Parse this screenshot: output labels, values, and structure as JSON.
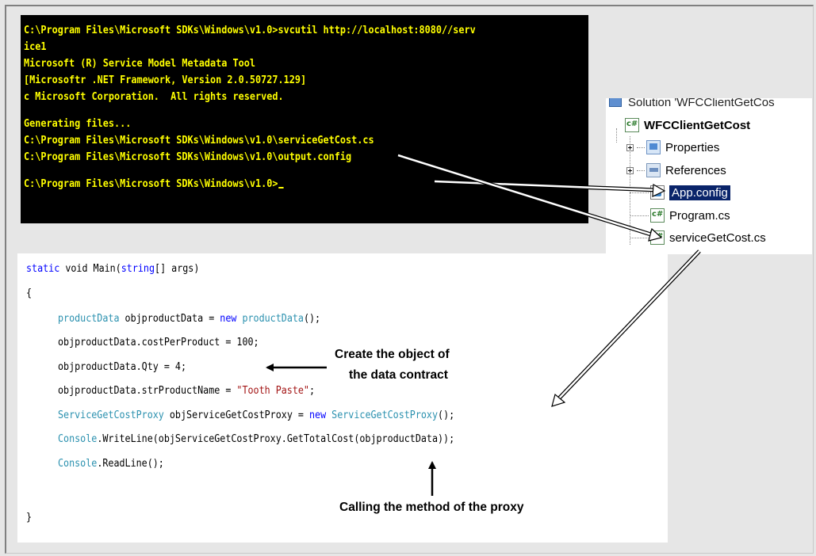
{
  "console": {
    "lines": [
      "C:\\Program Files\\Microsoft SDKs\\Windows\\v1.0>svcutil http://localhost:8080//serv",
      "ice1",
      "Microsoft (R) Service Model Metadata Tool",
      "[Microsoftr .NET Framework, Version 2.0.50727.129]",
      "c Microsoft Corporation.  All rights reserved.",
      "",
      "Generating files...",
      "C:\\Program Files\\Microsoft SDKs\\Windows\\v1.0\\serviceGetCost.cs",
      "C:\\Program Files\\Microsoft SDKs\\Windows\\v1.0\\output.config",
      "",
      "C:\\Program Files\\Microsoft SDKs\\Windows\\v1.0>"
    ]
  },
  "solution_explorer": {
    "solution_label": "Solution 'WFCClientGetCos",
    "project": "WFCClientGetCost",
    "items": [
      {
        "label": "Properties",
        "icon": "properties-folder-icon"
      },
      {
        "label": "References",
        "icon": "references-icon"
      },
      {
        "label": "App.config",
        "icon": "config-file-icon",
        "selected": true
      },
      {
        "label": "Program.cs",
        "icon": "csharp-file-icon"
      },
      {
        "label": "serviceGetCost.cs",
        "icon": "csharp-file-icon"
      }
    ]
  },
  "code": {
    "signature": [
      "static",
      " void Main(",
      "string",
      "[] args)"
    ],
    "open_brace": "{",
    "line1": [
      "productData",
      " objproductData = ",
      "new",
      " ",
      "productData",
      "();"
    ],
    "line2": "objproductData.costPerProduct = 100;",
    "line3": "objproductData.Qty = 4;",
    "line4": [
      "objproductData.strProductName = ",
      "\"Tooth Paste\"",
      ";"
    ],
    "line5": [
      "ServiceGetCostProxy",
      " objServiceGetCostProxy = ",
      "new",
      " ",
      "ServiceGetCostProxy",
      "();"
    ],
    "line6": [
      "Console",
      ".WriteLine(objServiceGetCostProxy.GetTotalCost(objproductData));"
    ],
    "line7": [
      "Console",
      ".ReadLine();"
    ],
    "close_brace": "}"
  },
  "annotations": {
    "data_contract_line1": "Create the object of",
    "data_contract_line2": "the data contract",
    "proxy_call": "Calling the method of the proxy"
  },
  "colors": {
    "console_bg": "#000000",
    "console_text": "#ffff00",
    "keyword": "#0000ff",
    "type": "#2b91af",
    "string": "#a31515",
    "selection": "#0a246a"
  }
}
